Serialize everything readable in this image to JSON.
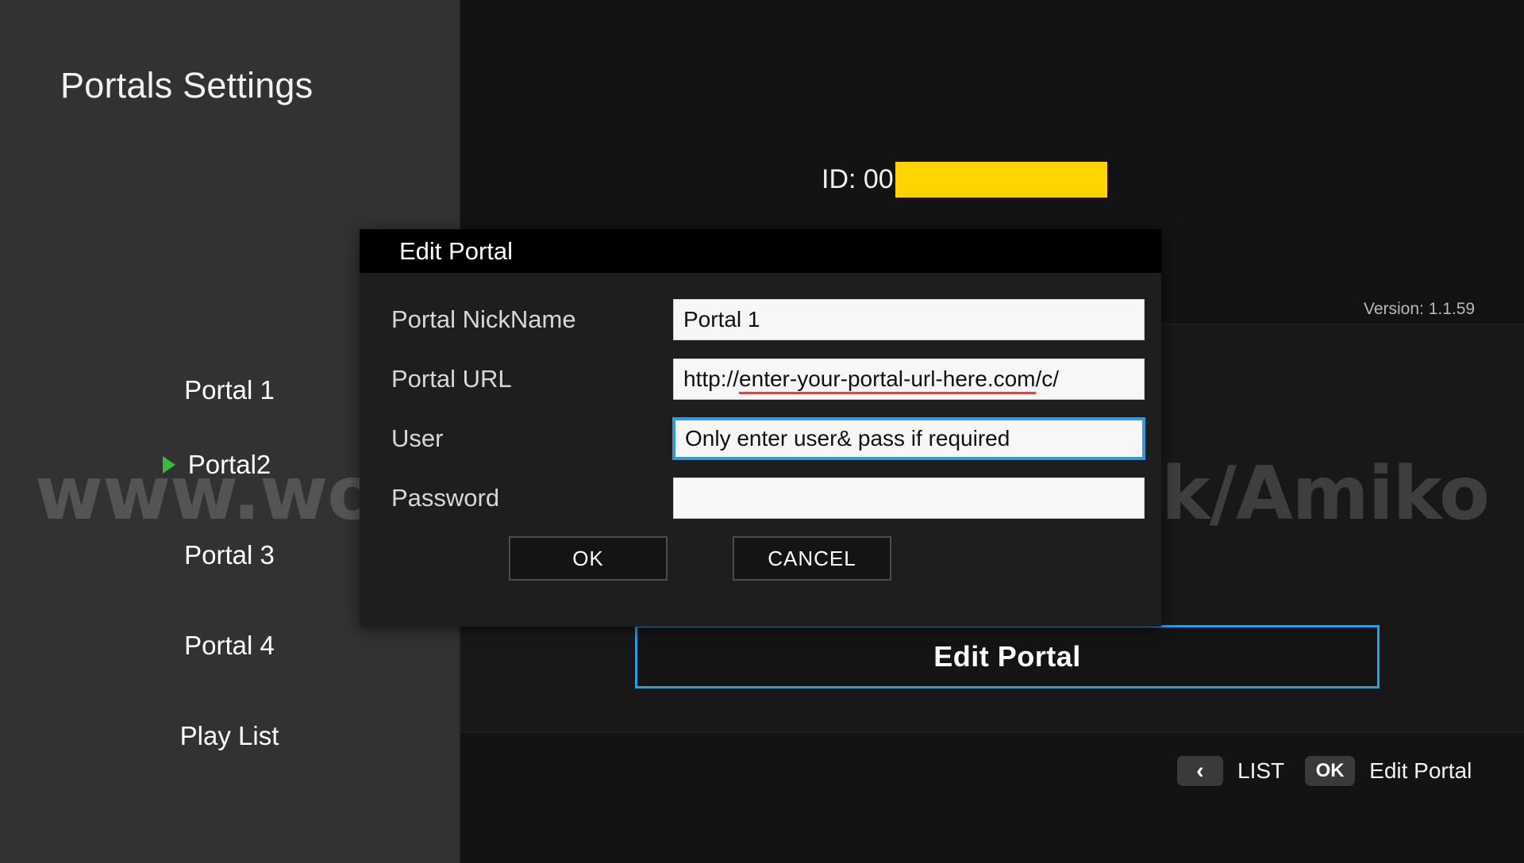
{
  "sidebar": {
    "title": "Portals Settings",
    "items": [
      {
        "label": "Portal 1",
        "selected": false
      },
      {
        "label": "Portal2",
        "selected": true
      },
      {
        "label": "Portal 3",
        "selected": false
      },
      {
        "label": "Portal 4",
        "selected": false
      },
      {
        "label": "Play List",
        "selected": false
      }
    ]
  },
  "main": {
    "id_label": "ID: 00",
    "id_redacted": true,
    "version": "Version: 1.1.59",
    "edit_portal_button": "Edit Portal"
  },
  "dialog": {
    "title": "Edit Portal",
    "fields": [
      {
        "label": "Portal NickName",
        "value": "Portal 1",
        "focused": false,
        "spell_error": false
      },
      {
        "label": "Portal URL",
        "value": "http://enter-your-portal-url-here.com/c/",
        "focused": false,
        "spell_error": true,
        "spell_prefix": "http://",
        "spell_body": "enter-your-portal-url-here.com",
        "spell_suffix": "/c/"
      },
      {
        "label": "User",
        "value": "Only enter user& pass if required",
        "focused": true,
        "spell_error": false
      },
      {
        "label": "Password",
        "value": "",
        "focused": false,
        "spell_error": false
      }
    ],
    "ok_label": "OK",
    "cancel_label": "CANCEL"
  },
  "keybar": {
    "back_key": "‹",
    "back_label": "LIST",
    "ok_key": "OK",
    "ok_label": "Edit Portal"
  },
  "watermark": {
    "text": "www.world-of-satellite.co.uk/Amiko"
  },
  "colors": {
    "accent_blue": "#22a0e8",
    "redaction_yellow": "#ffd400",
    "selected_marker_green": "#3cb93c",
    "spell_error_red": "#d04a4a",
    "sidebar_bg": "#323232",
    "main_bg": "#131313"
  }
}
